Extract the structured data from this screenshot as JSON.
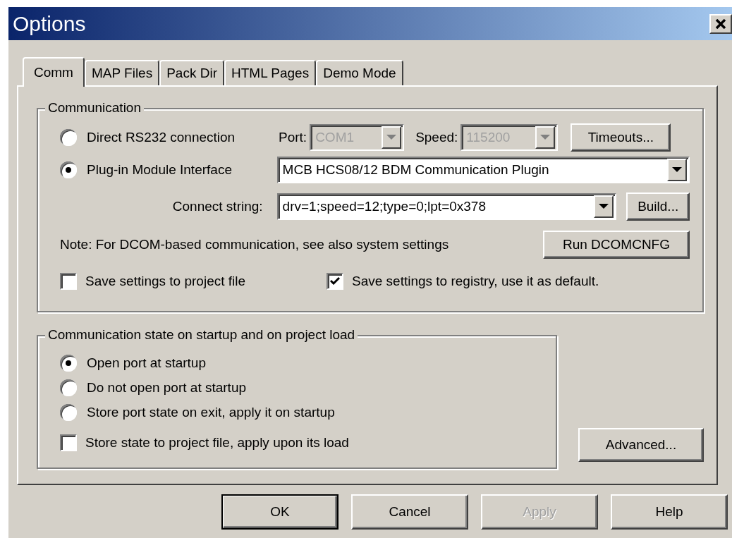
{
  "window": {
    "title": "Options"
  },
  "tabs": [
    {
      "label": "Comm",
      "selected": true
    },
    {
      "label": "MAP Files",
      "selected": false
    },
    {
      "label": "Pack Dir",
      "selected": false
    },
    {
      "label": "HTML Pages",
      "selected": false
    },
    {
      "label": "Demo Mode",
      "selected": false
    }
  ],
  "communication": {
    "legend": "Communication",
    "connection_modes": [
      {
        "label": "Direct RS232 connection",
        "selected": false
      },
      {
        "label": "Plug-in Module Interface",
        "selected": true
      }
    ],
    "port": {
      "label": "Port:",
      "value": "COM1",
      "disabled": true
    },
    "speed": {
      "label": "Speed:",
      "value": "115200",
      "disabled": true
    },
    "timeouts_button": "Timeouts...",
    "plugin": {
      "value": "MCB HCS08/12 BDM Communication Plugin"
    },
    "connect_string": {
      "label": "Connect string:",
      "value": "drv=1;speed=12;type=0;lpt=0x378"
    },
    "build_button": "Build...",
    "note": "Note: For DCOM-based communication, see also system settings",
    "dcom_button": "Run DCOMCNFG",
    "save_options": [
      {
        "label": "Save settings to project file",
        "checked": false
      },
      {
        "label": "Save settings to registry, use it as default.",
        "checked": true
      }
    ]
  },
  "startup": {
    "legend": "Communication state on startup and on project load",
    "options": [
      {
        "label": "Open port at startup",
        "selected": true
      },
      {
        "label": "Do not open port at startup",
        "selected": false
      },
      {
        "label": "Store port state on exit, apply it on startup",
        "selected": false
      }
    ],
    "store_state": {
      "label": "Store state to project file, apply upon its load",
      "checked": false
    }
  },
  "advanced_button": "Advanced...",
  "buttons": [
    {
      "label": "OK",
      "default": true,
      "disabled": false
    },
    {
      "label": "Cancel",
      "default": false,
      "disabled": false
    },
    {
      "label": "Apply",
      "default": false,
      "disabled": true
    },
    {
      "label": "Help",
      "default": false,
      "disabled": false
    }
  ]
}
